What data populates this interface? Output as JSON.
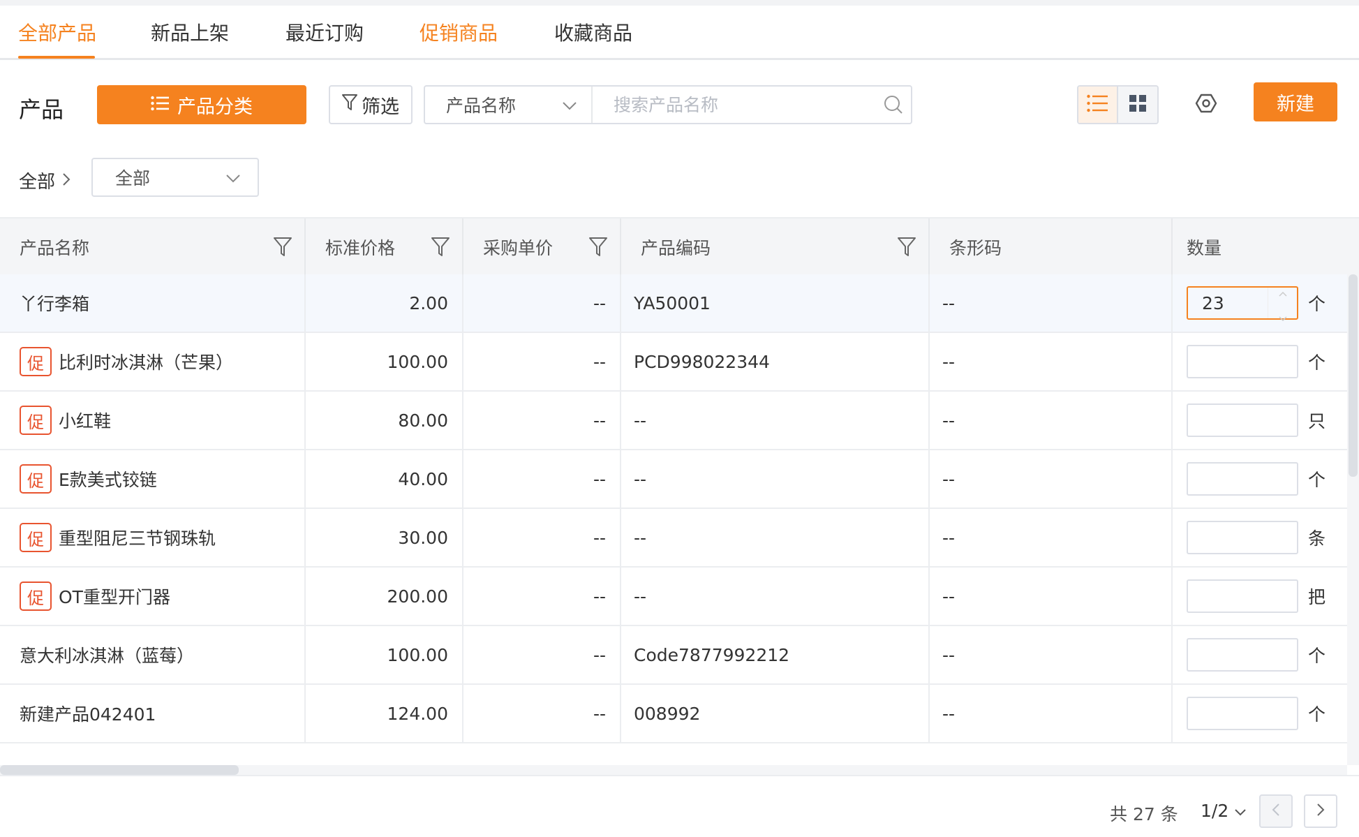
{
  "tabs": [
    {
      "label": "全部产品"
    },
    {
      "label": "新品上架"
    },
    {
      "label": "最近订购"
    },
    {
      "label": "促销商品"
    },
    {
      "label": "收藏商品"
    }
  ],
  "toolbar": {
    "title": "产品",
    "category_label": "产品分类",
    "filter_label": "筛选",
    "search_field": "产品名称",
    "search_placeholder": "搜索产品名称",
    "new_label": "新建"
  },
  "breadcrumb": {
    "root": "全部",
    "select_value": "全部"
  },
  "table": {
    "headers": [
      "产品名称",
      "标准价格",
      "采购单价",
      "产品编码",
      "条形码",
      "数量"
    ],
    "rows": [
      {
        "promo": false,
        "badge": "",
        "name": "丫行李箱",
        "price": "2.00",
        "purchase": "--",
        "code": "YA50001",
        "barcode": "--",
        "qty": "23",
        "unit": "个"
      },
      {
        "promo": true,
        "badge": "促",
        "name": "比利时冰淇淋（芒果）",
        "price": "100.00",
        "purchase": "--",
        "code": "PCD998022344",
        "barcode": "--",
        "qty": "",
        "unit": "个"
      },
      {
        "promo": true,
        "badge": "促",
        "name": "小红鞋",
        "price": "80.00",
        "purchase": "--",
        "code": "--",
        "barcode": "--",
        "qty": "",
        "unit": "只"
      },
      {
        "promo": true,
        "badge": "促",
        "name": "E款美式铰链",
        "price": "40.00",
        "purchase": "--",
        "code": "--",
        "barcode": "--",
        "qty": "",
        "unit": "个"
      },
      {
        "promo": true,
        "badge": "促",
        "name": "重型阻尼三节钢珠轨",
        "price": "30.00",
        "purchase": "--",
        "code": "--",
        "barcode": "--",
        "qty": "",
        "unit": "条"
      },
      {
        "promo": true,
        "badge": "促",
        "name": "OT重型开门器",
        "price": "200.00",
        "purchase": "--",
        "code": "--",
        "barcode": "--",
        "qty": "",
        "unit": "把"
      },
      {
        "promo": false,
        "badge": "",
        "name": "意大利冰淇淋（蓝莓）",
        "price": "100.00",
        "purchase": "--",
        "code": "Code7877992212",
        "barcode": "--",
        "qty": "",
        "unit": "个"
      },
      {
        "promo": false,
        "badge": "",
        "name": "新建产品042401",
        "price": "124.00",
        "purchase": "--",
        "code": "008992",
        "barcode": "--",
        "qty": "",
        "unit": "个"
      }
    ]
  },
  "pagination": {
    "total": "共 27 条",
    "page": "1/2"
  },
  "colors": {
    "accent": "#f5821f",
    "promo_badge": "#e8542f"
  },
  "icons": {
    "list": "list-icon",
    "filter": "filter-icon",
    "search": "search-icon",
    "grid": "grid-icon",
    "settings": "settings-icon"
  }
}
